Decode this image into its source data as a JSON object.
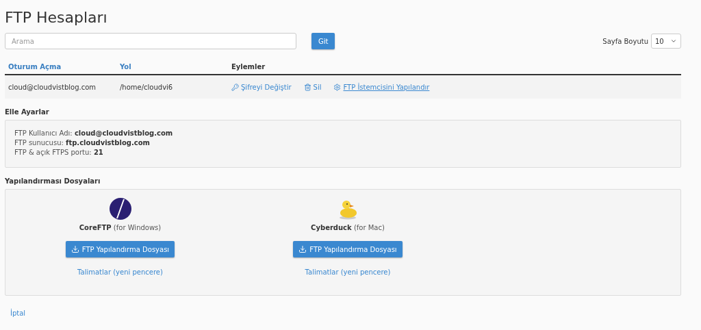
{
  "title": "FTP Hesapları",
  "search": {
    "placeholder": "Arama",
    "button": "Git"
  },
  "page_size": {
    "label": "Sayfa Boyutu",
    "value": "10"
  },
  "table": {
    "columns": [
      "Oturum Açma",
      "Yol",
      "Eylemler"
    ],
    "rows": [
      {
        "login": "cloud@cloudvistblog.com",
        "path": "/home/cloudvi6",
        "actions": [
          {
            "kind": "key",
            "label": "Şifreyi Değiştir",
            "underlined": false
          },
          {
            "kind": "trash",
            "label": "Sil",
            "underlined": false
          },
          {
            "kind": "gear",
            "label": "FTP İstemcisini Yapılandır",
            "underlined": true
          }
        ]
      }
    ]
  },
  "manual": {
    "heading": "Elle Ayarlar",
    "lines": [
      {
        "label": "FTP Kullanıcı Adı:",
        "value": "cloud@cloudvistblog.com"
      },
      {
        "label": "FTP sunucusu:",
        "value": "ftp.cloudvistblog.com"
      },
      {
        "label": "FTP & açık FTPS portu: ",
        "value": "21"
      }
    ]
  },
  "config_files": {
    "heading": "Yapılandırması Dosyaları",
    "clients": [
      {
        "kind": "coreftp",
        "name": "CoreFTP",
        "platform": "(for Windows)",
        "button": "FTP Yapılandırma Dosyası",
        "link": "Talimatlar (yeni pencere)"
      },
      {
        "kind": "cyberduck",
        "name": "Cyberduck",
        "platform": "(for Mac)",
        "button": "FTP Yapılandırma Dosyası",
        "link": "Talimatlar (yeni pencere)"
      }
    ]
  },
  "cancel": "İptal"
}
